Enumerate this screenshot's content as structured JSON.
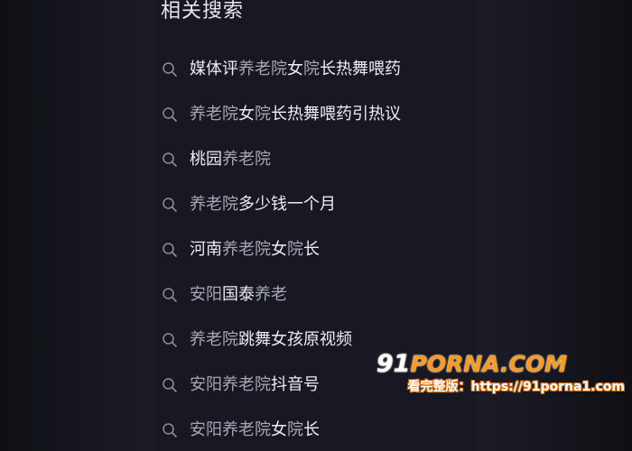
{
  "section": {
    "title": "相关搜索"
  },
  "suggestions": [
    {
      "parts": [
        {
          "t": "媒体评",
          "h": false
        },
        {
          "t": "养老院",
          "h": true
        },
        {
          "t": "女",
          "h": false
        },
        {
          "t": "院",
          "h": true
        },
        {
          "t": "长热舞喂药",
          "h": false
        }
      ]
    },
    {
      "parts": [
        {
          "t": "养老院",
          "h": true
        },
        {
          "t": "女",
          "h": false
        },
        {
          "t": "院",
          "h": true
        },
        {
          "t": "长热舞喂药引热议",
          "h": false
        }
      ]
    },
    {
      "parts": [
        {
          "t": "桃园",
          "h": false
        },
        {
          "t": "养老院",
          "h": true
        }
      ]
    },
    {
      "parts": [
        {
          "t": "养老院",
          "h": true
        },
        {
          "t": "多少钱一个月",
          "h": false
        }
      ]
    },
    {
      "parts": [
        {
          "t": "河南",
          "h": false
        },
        {
          "t": "养老院",
          "h": true
        },
        {
          "t": "女",
          "h": false
        },
        {
          "t": "院",
          "h": true
        },
        {
          "t": "长",
          "h": false
        }
      ]
    },
    {
      "parts": [
        {
          "t": "安阳",
          "h": true
        },
        {
          "t": "国泰",
          "h": false
        },
        {
          "t": "养老",
          "h": true
        }
      ]
    },
    {
      "parts": [
        {
          "t": "养老院",
          "h": true
        },
        {
          "t": "跳舞女孩原视频",
          "h": false
        }
      ]
    },
    {
      "parts": [
        {
          "t": "安阳养老院",
          "h": true
        },
        {
          "t": "抖音号",
          "h": false
        }
      ]
    },
    {
      "parts": [
        {
          "t": "安阳养老院",
          "h": true
        },
        {
          "t": "女",
          "h": false
        },
        {
          "t": "院",
          "h": true
        },
        {
          "t": "长",
          "h": false
        }
      ]
    }
  ],
  "icons": {
    "search": "search-icon"
  },
  "watermark": {
    "logo_number": "91",
    "logo_text": "PORNA.COM",
    "line": "看完整版：https://91porna1.com"
  },
  "colors": {
    "background": "#171821",
    "text": "#ececf2",
    "highlight": "#a6a7b4",
    "icon": "#8e8e98",
    "watermark": "#ff9a1f"
  }
}
